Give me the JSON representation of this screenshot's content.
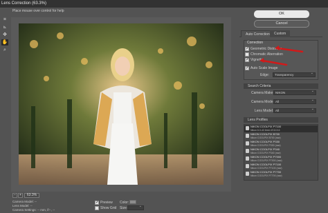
{
  "window": {
    "title": "Lens Correction (63.3%)"
  },
  "hint": "Place mouse over control for help",
  "tools": [
    {
      "name": "remove-distortion-tool",
      "glyph": "⌗"
    },
    {
      "name": "straighten-tool",
      "glyph": "⦝"
    },
    {
      "name": "move-grid-tool",
      "glyph": "✥"
    },
    {
      "name": "hand-tool",
      "glyph": "✋"
    },
    {
      "name": "zoom-tool",
      "glyph": "⌕"
    }
  ],
  "buttons": {
    "ok": "OK",
    "cancel": "Cancel"
  },
  "tabs": {
    "auto": "Auto Correction",
    "custom": "Custom"
  },
  "correction": {
    "heading": "Correction",
    "geometric": "Geometric Distortion",
    "chromatic": "Chromatic Aberration",
    "vignette": "Vignette",
    "auto_scale": "Auto Scale Image",
    "edge_label": "Edge:",
    "edge_value": "Transparency"
  },
  "search": {
    "heading": "Search Criteria",
    "camera_make_label": "Camera Make:",
    "camera_make_value": "NIKON",
    "camera_model_label": "Camera Model:",
    "camera_model_value": "All",
    "lens_model_label": "Lens Model:",
    "lens_model_value": "All"
  },
  "profiles": {
    "heading": "Lens Profiles",
    "items": [
      {
        "name": "NIKON COOLPIX P7100",
        "detail": "Nikon 6.0-42.6mm f/2.8-5.6"
      },
      {
        "name": "NIKON COOLPIX B700",
        "detail": "Nikon COOLPIX B700 (raw)"
      },
      {
        "name": "NIKON COOLPIX P330",
        "detail": "Nikon COOLPIX P330 (raw)"
      },
      {
        "name": "NIKON COOLPIX P340",
        "detail": "Nikon COOLPIX P340 (raw)"
      },
      {
        "name": "NIKON COOLPIX P7000",
        "detail": "Nikon COOLPIX P7000 (raw)"
      },
      {
        "name": "NIKON COOLPIX P7100",
        "detail": "Nikon COOLPIX P7100 (raw)"
      },
      {
        "name": "NIKON COOLPIX P7700",
        "detail": "Nikon COOLPIX P7700 (raw)"
      }
    ]
  },
  "status": {
    "zoom_out": "−",
    "zoom_in": "+",
    "zoom_value": "63.3%",
    "camera_model": "Camera Model: --",
    "lens_model": "Lens Model: --",
    "camera_settings": "Camera Settings: -- mm, f/--, --"
  },
  "bottom": {
    "preview": "Preview",
    "show_grid": "Show Grid",
    "color_label": "Color:",
    "size_label": "Size:"
  },
  "colors": {
    "accent_arrow": "#d11a1a",
    "ok_button": "#e9e9e9",
    "panel": "#535353"
  }
}
